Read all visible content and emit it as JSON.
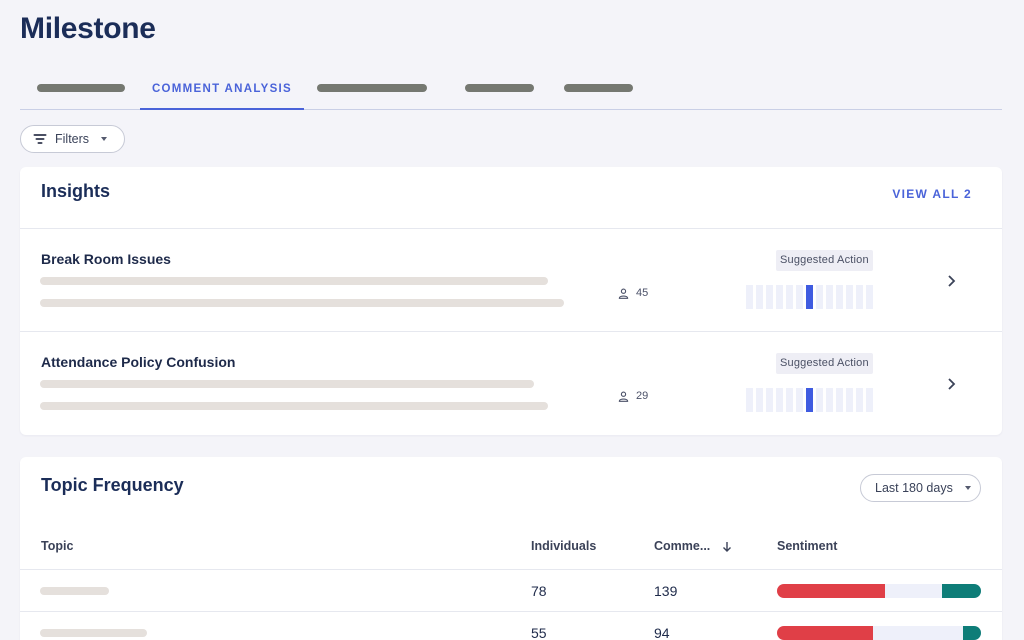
{
  "page": {
    "title": "Milestone"
  },
  "tabs": {
    "active_label": "COMMENT ANALYSIS"
  },
  "filters": {
    "label": "Filters"
  },
  "insights": {
    "title": "Insights",
    "view_all_label": "VIEW ALL 2",
    "items": [
      {
        "title": "Break Room Issues",
        "count": "45",
        "badge": "Suggested Action",
        "active_segment": 6
      },
      {
        "title": "Attendance Policy Confusion",
        "count": "29",
        "badge": "Suggested Action",
        "active_segment": 6
      }
    ]
  },
  "topic_frequency": {
    "title": "Topic Frequency",
    "range_select": "Last 180 days",
    "columns": {
      "topic": "Topic",
      "individuals": "Individuals",
      "comments": "Comme...",
      "sentiment": "Sentiment"
    },
    "rows": [
      {
        "individuals": "78",
        "comments": "139",
        "sentiment": {
          "negative": 0.53,
          "neutral": 0.28,
          "positive": 0.19
        }
      },
      {
        "individuals": "55",
        "comments": "94",
        "sentiment": {
          "negative": 0.47,
          "neutral": 0.44,
          "positive": 0.09
        }
      }
    ]
  },
  "colors": {
    "accent": "#4a63d9",
    "title": "#1b2d58",
    "negative": "#e03f47",
    "positive": "#0e7d78",
    "redacted": "#757871"
  },
  "icons": {
    "filters": "filter-lines-icon",
    "caret": "caret-down-icon",
    "person": "person-icon",
    "chevron": "chevron-right-icon",
    "sort": "arrow-down-icon"
  }
}
